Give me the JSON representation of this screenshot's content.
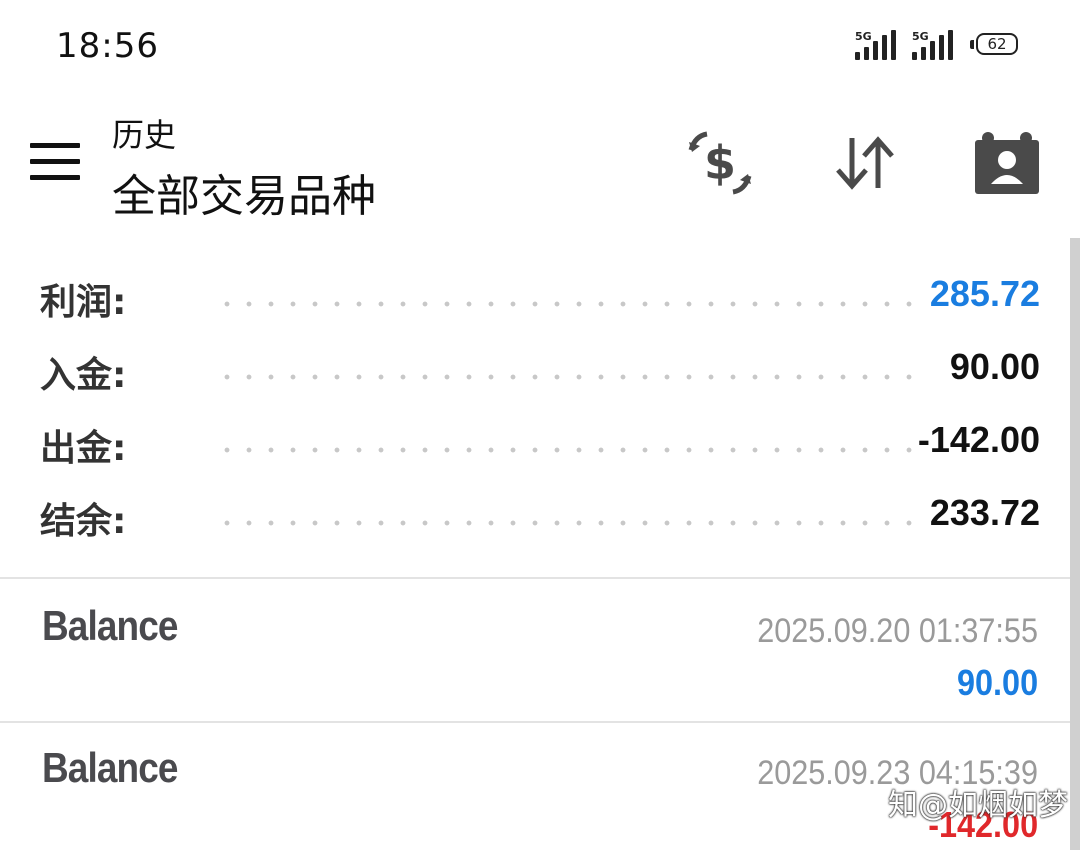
{
  "status_bar": {
    "time": "18:56",
    "network_1": "5G",
    "network_2": "5G",
    "battery": "62"
  },
  "header": {
    "subtitle": "历史",
    "title": "全部交易品种",
    "icons": [
      "menu-icon",
      "currency-exchange-icon",
      "sort-icon",
      "account-badge-icon"
    ]
  },
  "summary": {
    "profit": {
      "label": "利润:",
      "value": "285.72",
      "color": "#1a7de0"
    },
    "deposit": {
      "label": "入金:",
      "value": "90.00"
    },
    "withdrawal": {
      "label": "出金:",
      "value": "-142.00"
    },
    "balance": {
      "label": "结余:",
      "value": "233.72"
    }
  },
  "deals": [
    {
      "type": "Balance",
      "time": "2025.09.20 01:37:55",
      "amount": "90.00",
      "color": "#1a7de0"
    },
    {
      "type": "Balance",
      "time": "2025.09.23 04:15:39",
      "amount": "-142.00",
      "color": "#e0282b"
    }
  ],
  "watermark": "知@如烟如梦"
}
